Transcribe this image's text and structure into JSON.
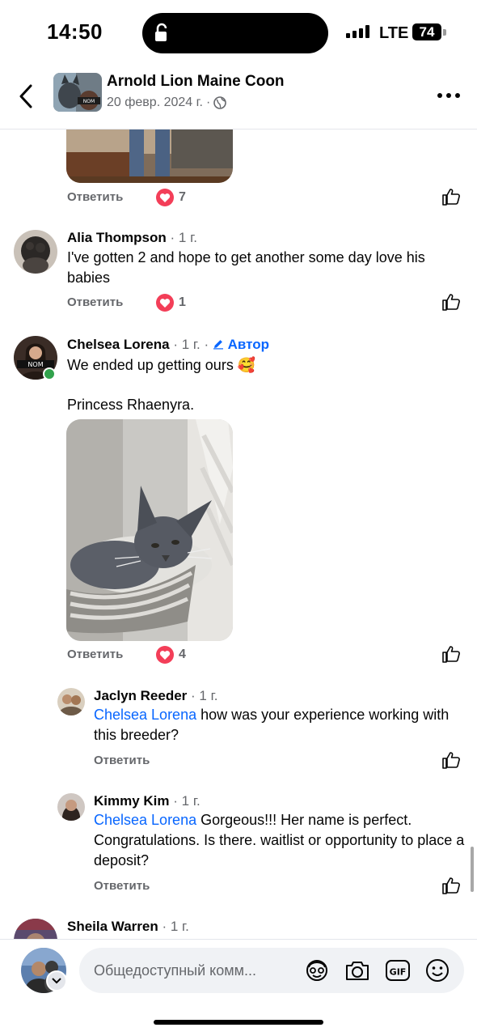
{
  "status_bar": {
    "time": "14:50",
    "network": "LTE",
    "battery": "74"
  },
  "header": {
    "page_name": "Arnold Lion Maine Coon",
    "date": "20 февр. 2024 г.",
    "separator": "·"
  },
  "top_comment": {
    "reply_label": "Ответить",
    "reaction_count": "7"
  },
  "comments": [
    {
      "name": "Alia Thompson",
      "age": "· 1 г.",
      "text": "I've gotten 2 and hope to get another some day love his babies",
      "reply_label": "Ответить",
      "reaction_count": "1"
    },
    {
      "name": "Chelsea Lorena",
      "age": "· 1 г. ·",
      "author_badge": "Автор",
      "text_line1": "We ended up getting ours 🥰",
      "text_line2": "Princess Rhaenyra.",
      "reply_label": "Ответить",
      "reaction_count": "4"
    }
  ],
  "replies": [
    {
      "name": "Jaclyn Reeder",
      "age": "· 1 г.",
      "mention": "Chelsea Lorena",
      "text": " how was your experience working with this breeder?",
      "reply_label": "Ответить"
    },
    {
      "name": "Kimmy Kim",
      "age": "· 1 г.",
      "mention": "Chelsea Lorena",
      "text": " Gorgeous!!! Her name is perfect. Congratulations. Is there. waitlist or opportunity to place a deposit?",
      "reply_label": "Ответить"
    }
  ],
  "next_comment": {
    "name": "Sheila Warren",
    "age": "· 1 г."
  },
  "composer": {
    "placeholder": "Общедоступный комм..."
  },
  "colors": {
    "accent": "#0866ff",
    "love": "#f33e58",
    "muted": "#65676b"
  }
}
